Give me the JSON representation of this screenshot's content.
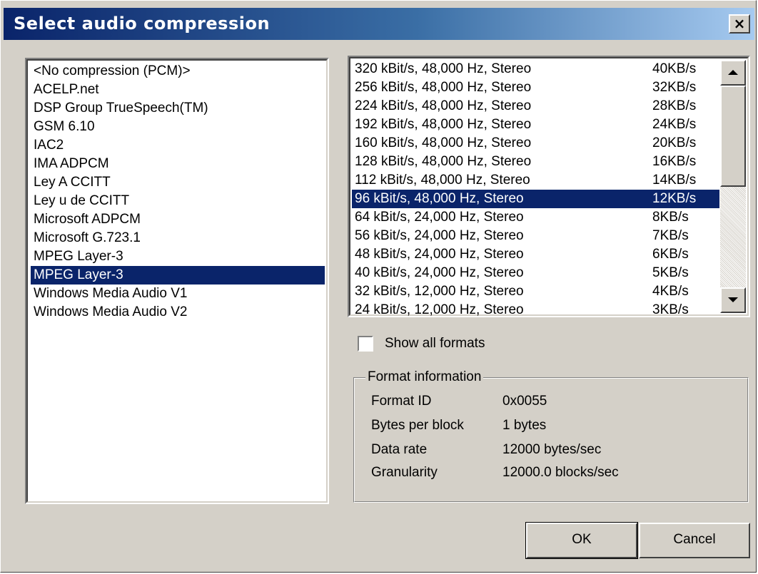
{
  "window": {
    "title": "Select audio compression",
    "close_label": "×"
  },
  "codecs": {
    "items": [
      "<No compression (PCM)>",
      "ACELP.net",
      "DSP Group TrueSpeech(TM)",
      "GSM 6.10",
      "IAC2",
      "IMA ADPCM",
      "Ley A CCITT",
      "Ley u de CCITT",
      "Microsoft ADPCM",
      "Microsoft G.723.1",
      "MPEG Layer-3",
      "MPEG Layer-3",
      "Windows Media Audio V1",
      "Windows Media Audio V2"
    ],
    "selected_index": 11
  },
  "formats": {
    "items": [
      {
        "desc": "320 kBit/s, 48,000 Hz, Stereo",
        "rate": "40KB/s"
      },
      {
        "desc": "256 kBit/s, 48,000 Hz, Stereo",
        "rate": "32KB/s"
      },
      {
        "desc": "224 kBit/s, 48,000 Hz, Stereo",
        "rate": "28KB/s"
      },
      {
        "desc": "192 kBit/s, 48,000 Hz, Stereo",
        "rate": "24KB/s"
      },
      {
        "desc": "160 kBit/s, 48,000 Hz, Stereo",
        "rate": "20KB/s"
      },
      {
        "desc": "128 kBit/s, 48,000 Hz, Stereo",
        "rate": "16KB/s"
      },
      {
        "desc": "112 kBit/s, 48,000 Hz, Stereo",
        "rate": "14KB/s"
      },
      {
        "desc": "96 kBit/s, 48,000 Hz, Stereo",
        "rate": "12KB/s"
      },
      {
        "desc": "64 kBit/s, 24,000 Hz, Stereo",
        "rate": "8KB/s"
      },
      {
        "desc": "56 kBit/s, 24,000 Hz, Stereo",
        "rate": "7KB/s"
      },
      {
        "desc": "48 kBit/s, 24,000 Hz, Stereo",
        "rate": "6KB/s"
      },
      {
        "desc": "40 kBit/s, 24,000 Hz, Stereo",
        "rate": "5KB/s"
      },
      {
        "desc": "32 kBit/s, 12,000 Hz, Stereo",
        "rate": "4KB/s"
      },
      {
        "desc": "24 kBit/s, 12,000 Hz, Stereo",
        "rate": "3KB/s"
      }
    ],
    "selected_index": 7
  },
  "show_all_formats": {
    "label": "Show all formats",
    "checked": false
  },
  "format_info": {
    "legend": "Format information",
    "rows": [
      {
        "label": "Format ID",
        "value": "0x0055"
      },
      {
        "label": "Bytes per block",
        "value": "1 bytes"
      },
      {
        "label": "Data rate",
        "value": "12000 bytes/sec"
      },
      {
        "label": "Granularity",
        "value": "12000.0 blocks/sec"
      }
    ]
  },
  "buttons": {
    "ok": "OK",
    "cancel": "Cancel"
  },
  "colors": {
    "selection": "#0a246a",
    "face": "#d4d0c8"
  }
}
